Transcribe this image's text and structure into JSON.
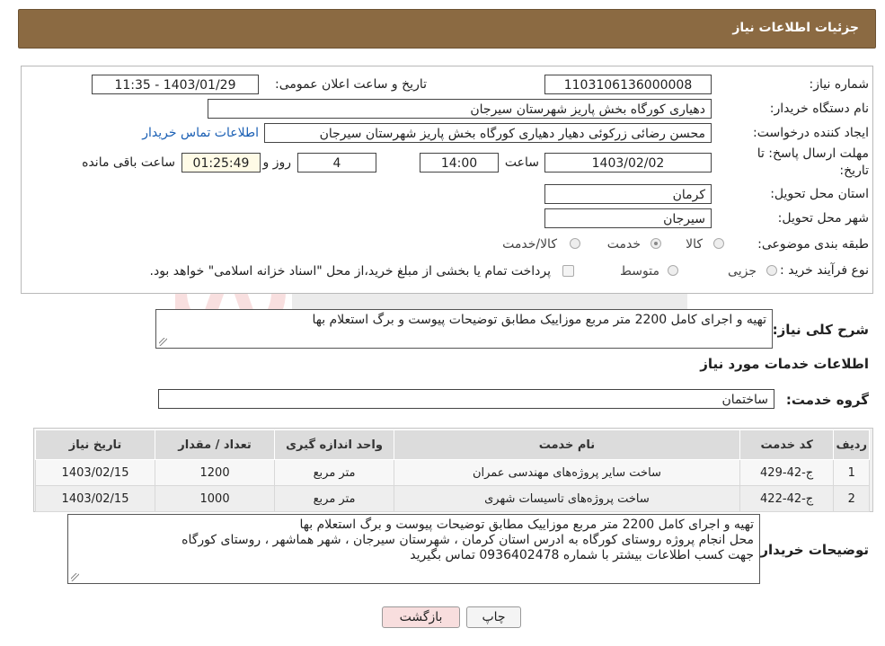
{
  "header": {
    "title": "جزئیات اطلاعات نیاز"
  },
  "form": {
    "need_number_label": "شماره نیاز:",
    "need_number": "1103106136000008",
    "announce_label": "تاریخ و ساعت اعلان عمومی:",
    "announce_value": "1403/01/29 - 11:35",
    "buyer_org_label": "نام دستگاه خریدار:",
    "buyer_org": "دهیاری کورگاه بخش پاریز شهرستان سیرجان",
    "creator_label": "ایجاد کننده درخواست:",
    "creator": "محسن رضائی زرکوئی دهیار دهیاری کورگاه بخش پاریز شهرستان سیرجان",
    "contact_link": "اطلاعات تماس خریدار",
    "deadline_label_line1": "مهلت ارسال پاسخ: تا",
    "deadline_label_line2": "تاریخ:",
    "deadline_date": "1403/02/02",
    "time_label": "ساعت",
    "deadline_time": "14:00",
    "days": "4",
    "days_label": "روز و",
    "remaining": "01:25:49",
    "remaining_label": "ساعت باقی مانده",
    "province_label": "استان محل تحویل:",
    "province": "کرمان",
    "city_label": "شهر محل تحویل:",
    "city": "سیرجان",
    "category_label": "طبقه بندی موضوعی:",
    "category_options": [
      "کالا",
      "خدمت",
      "کالا/خدمت"
    ],
    "category_selected": "خدمت",
    "process_label": "نوع فرآیند خرید :",
    "process_options": [
      "جزیی",
      "متوسط"
    ],
    "payment_note": "پرداخت تمام یا بخشی از مبلغ خرید،از محل \"اسناد خزانه اسلامی\" خواهد بود."
  },
  "summary": {
    "label": "شرح کلی نیاز:",
    "text": "تهیه و اجرای کامل 2200 متر مربع موزاییک مطابق توضیحات پیوست و برگ استعلام بها"
  },
  "services": {
    "section_title": "اطلاعات خدمات مورد نیاز",
    "group_label": "گروه خدمت:",
    "group_value": "ساختمان",
    "columns": [
      "ردیف",
      "کد خدمت",
      "نام خدمت",
      "واحد اندازه گیری",
      "تعداد / مقدار",
      "تاریخ نیاز"
    ],
    "rows": [
      [
        "1",
        "ج-42-429",
        "ساخت سایر پروژه‌های مهندسی عمران",
        "متر مربع",
        "1200",
        "1403/02/15"
      ],
      [
        "2",
        "ج-42-422",
        "ساخت پروژه‌های تاسیسات شهری",
        "متر مربع",
        "1000",
        "1403/02/15"
      ]
    ]
  },
  "buyer_notes": {
    "label": "توضیحات خریدار:",
    "lines": [
      "تهیه و اجرای کامل 2200 متر مربع موزاییک مطابق توضیحات پیوست و برگ استعلام بها",
      "محل انجام پروژه روستای کورگاه به ادرس استان کرمان ، شهرستان سیرجان ،  شهر هماشهر ، روستای کورگاه",
      "جهت کسب اطلاعات بیشتر با شماره 0936402478 تماس بگیرید"
    ]
  },
  "buttons": {
    "print": "چاپ",
    "back": "بازگشت"
  },
  "colors": {
    "header_bg": "#8b6a42",
    "link": "#1a5fb4",
    "back_button_bg": "#f8dede"
  }
}
